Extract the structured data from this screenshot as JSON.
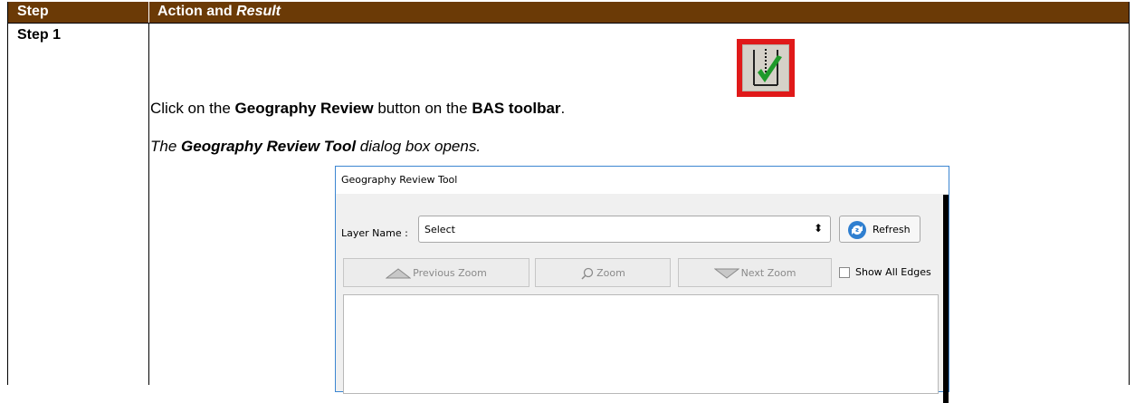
{
  "table": {
    "header_step": "Step",
    "header_action": "Action and ",
    "header_result": "Result",
    "step_label": "Step 1"
  },
  "instruction": {
    "pre": "Click on the ",
    "b1": "Geography Review",
    "mid": " button on the ",
    "b2": "BAS toolbar",
    "post": "."
  },
  "result_line": {
    "pre": "The ",
    "bold": "Geography Review Tool",
    "post": " dialog box opens."
  },
  "icon": {
    "name": "geography-review-icon",
    "highlight_color": "#e01919"
  },
  "dialog": {
    "title": "Geography Review Tool",
    "layer_label": "Layer Name :",
    "layer_value": "Select",
    "refresh": "Refresh",
    "previous_zoom": "Previous Zoom",
    "zoom": "Zoom",
    "next_zoom": "Next Zoom",
    "show_all_edges": "Show All Edges"
  },
  "colors": {
    "header_bg": "#6b3a06",
    "dialog_border": "#3c86d1"
  }
}
